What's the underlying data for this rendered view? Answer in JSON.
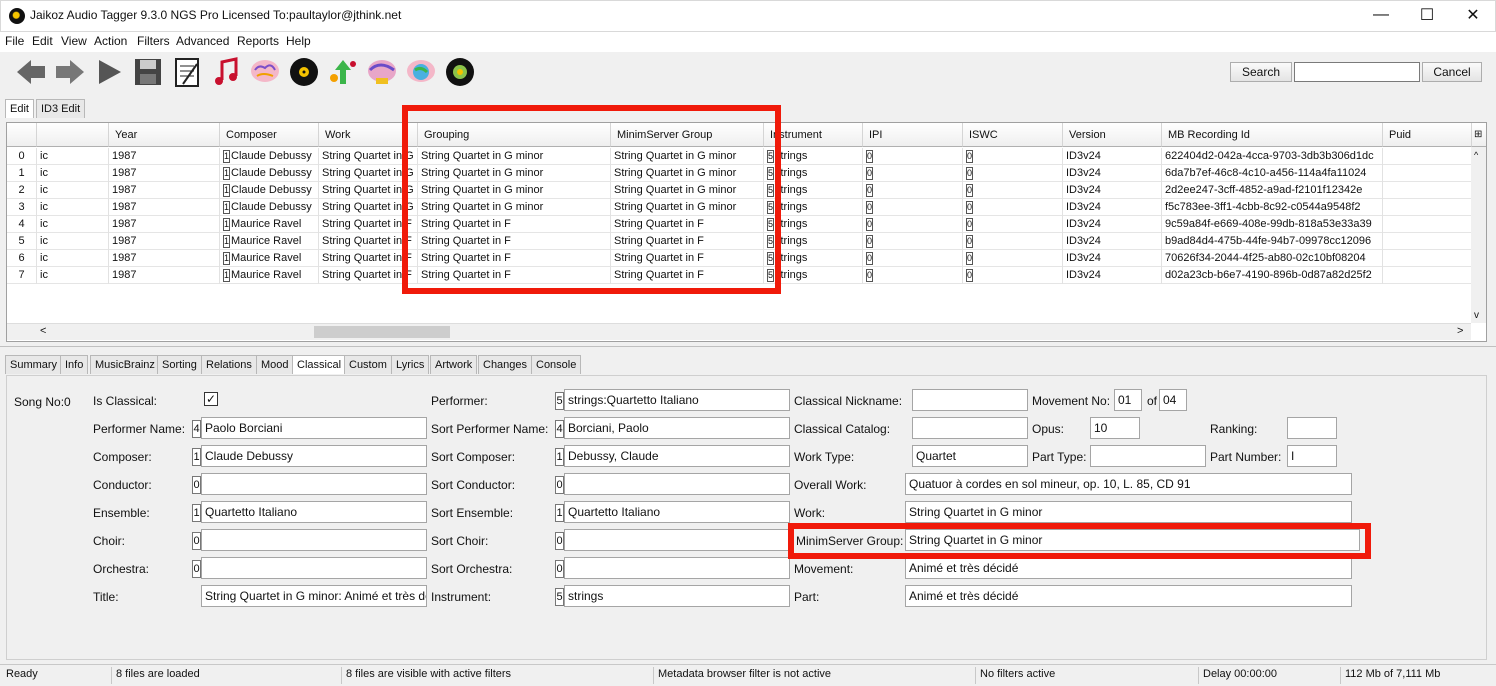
{
  "window": {
    "title": "Jaikoz Audio Tagger 9.3.0 NGS Pro Licensed To:paultaylor@jthink.net",
    "minimize": "—",
    "maximize": "☐",
    "close": "✕"
  },
  "menu": [
    "File",
    "Edit",
    "View",
    "Action",
    "Filters",
    "Advanced",
    "Reports",
    "Help"
  ],
  "toolbar": {
    "icons": [
      "back-arrow-icon",
      "forward-arrow-icon",
      "play-icon",
      "save-icon",
      "notepad-icon",
      "music-note-icon",
      "brain-icon",
      "vinyl-record-icon",
      "upload-tree-icon",
      "brain-sweep-icon",
      "brain-globe-icon",
      "disc-icon"
    ],
    "search_label": "Search",
    "cancel_label": "Cancel",
    "search_value": ""
  },
  "top_tabs": [
    "Edit",
    "ID3 Edit"
  ],
  "grid": {
    "columns": [
      "",
      "Year",
      "Composer",
      "Work",
      "Grouping",
      "MinimServer Group",
      "Instrument",
      "IPI",
      "ISWC",
      "Version",
      "MB Recording Id",
      "Puid"
    ],
    "rows": [
      {
        "n": "0",
        "c": "ic",
        "year": "1987",
        "cc": "1",
        "composer": "Claude Debussy",
        "work": "String Quartet in G minor",
        "grouping": "String Quartet in G minor",
        "msg": "String Quartet in G minor",
        "ic": "5",
        "instrument": "strings",
        "ipi": "0",
        "iswc": "0",
        "version": "ID3v24",
        "mbid": "622404d2-042a-4cca-9703-3db3b306d1dc"
      },
      {
        "n": "1",
        "c": "ic",
        "year": "1987",
        "cc": "1",
        "composer": "Claude Debussy",
        "work": "String Quartet in G minor",
        "grouping": "String Quartet in G minor",
        "msg": "String Quartet in G minor",
        "ic": "5",
        "instrument": "strings",
        "ipi": "0",
        "iswc": "0",
        "version": "ID3v24",
        "mbid": "6da7b7ef-46c8-4c10-a456-114a4fa11024"
      },
      {
        "n": "2",
        "c": "ic",
        "year": "1987",
        "cc": "1",
        "composer": "Claude Debussy",
        "work": "String Quartet in G minor",
        "grouping": "String Quartet in G minor",
        "msg": "String Quartet in G minor",
        "ic": "5",
        "instrument": "strings",
        "ipi": "0",
        "iswc": "0",
        "version": "ID3v24",
        "mbid": "2d2ee247-3cff-4852-a9ad-f2101f12342e"
      },
      {
        "n": "3",
        "c": "ic",
        "year": "1987",
        "cc": "1",
        "composer": "Claude Debussy",
        "work": "String Quartet in G minor",
        "grouping": "String Quartet in G minor",
        "msg": "String Quartet in G minor",
        "ic": "5",
        "instrument": "strings",
        "ipi": "0",
        "iswc": "0",
        "version": "ID3v24",
        "mbid": "f5c783ee-3ff1-4cbb-8c92-c0544a9548f2"
      },
      {
        "n": "4",
        "c": "ic",
        "year": "1987",
        "cc": "1",
        "composer": "Maurice Ravel",
        "work": "String Quartet in F",
        "grouping": "String Quartet in F",
        "msg": "String Quartet in F",
        "ic": "5",
        "instrument": "strings",
        "ipi": "0",
        "iswc": "0",
        "version": "ID3v24",
        "mbid": "9c59a84f-e669-408e-99db-818a53e33a39"
      },
      {
        "n": "5",
        "c": "ic",
        "year": "1987",
        "cc": "1",
        "composer": "Maurice Ravel",
        "work": "String Quartet in F",
        "grouping": "String Quartet in F",
        "msg": "String Quartet in F",
        "ic": "5",
        "instrument": "strings",
        "ipi": "0",
        "iswc": "0",
        "version": "ID3v24",
        "mbid": "b9ad84d4-475b-44fe-94b7-09978cc12096"
      },
      {
        "n": "6",
        "c": "ic",
        "year": "1987",
        "cc": "1",
        "composer": "Maurice Ravel",
        "work": "String Quartet in F",
        "grouping": "String Quartet in F",
        "msg": "String Quartet in F",
        "ic": "5",
        "instrument": "strings",
        "ipi": "0",
        "iswc": "0",
        "version": "ID3v24",
        "mbid": "70626f34-2044-4f25-ab80-02c10bf08204"
      },
      {
        "n": "7",
        "c": "ic",
        "year": "1987",
        "cc": "1",
        "composer": "Maurice Ravel",
        "work": "String Quartet in F",
        "grouping": "String Quartet in F",
        "msg": "String Quartet in F",
        "ic": "5",
        "instrument": "strings",
        "ipi": "0",
        "iswc": "0",
        "version": "ID3v24",
        "mbid": "d02a23cb-b6e7-4190-896b-0d87a82d25f2"
      }
    ]
  },
  "bottom_tabs": [
    "Summary",
    "Info",
    "MusicBrainz",
    "Sorting",
    "Relations",
    "Mood",
    "Classical",
    "Custom",
    "Lyrics",
    "Artwork",
    "Changes",
    "Console"
  ],
  "form": {
    "song_no": "Song No:0",
    "is_classical_label": "Is Classical:",
    "is_classical_check": "✓",
    "performer_name_label": "Performer Name:",
    "performer_name_count": "4",
    "performer_name": "Paolo Borciani",
    "composer_label": "Composer:",
    "composer_count": "1",
    "composer": "Claude Debussy",
    "conductor_label": "Conductor:",
    "conductor_count": "0",
    "conductor": "",
    "ensemble_label": "Ensemble:",
    "ensemble_count": "1",
    "ensemble": "Quartetto Italiano",
    "choir_label": "Choir:",
    "choir_count": "0",
    "choir": "",
    "orchestra_label": "Orchestra:",
    "orchestra_count": "0",
    "orchestra": "",
    "title_label": "Title:",
    "title": "String Quartet in G minor: Animé et très décidé",
    "performer_label": "Performer:",
    "performer_count": "5",
    "performer": "strings:Quartetto Italiano",
    "sort_performer_name_label": "Sort Performer Name:",
    "sort_performer_name_count": "4",
    "sort_performer_name": "Borciani, Paolo",
    "sort_composer_label": "Sort Composer:",
    "sort_composer_count": "1",
    "sort_composer": "Debussy, Claude",
    "sort_conductor_label": "Sort Conductor:",
    "sort_conductor_count": "0",
    "sort_conductor": "",
    "sort_ensemble_label": "Sort Ensemble:",
    "sort_ensemble_count": "1",
    "sort_ensemble": "Quartetto Italiano",
    "sort_choir_label": "Sort Choir:",
    "sort_choir_count": "0",
    "sort_choir": "",
    "sort_orchestra_label": "Sort Orchestra:",
    "sort_orchestra_count": "0",
    "sort_orchestra": "",
    "instrument_label": "Instrument:",
    "instrument_count": "5",
    "instrument": "strings",
    "classical_nickname_label": "Classical Nickname:",
    "classical_nickname": "",
    "classical_catalog_label": "Classical Catalog:",
    "classical_catalog": "",
    "work_type_label": "Work Type:",
    "work_type": "Quartet",
    "overall_work_label": "Overall Work:",
    "overall_work": "Quatuor à cordes en sol mineur, op. 10, L. 85, CD 91",
    "work_label": "Work:",
    "work": "String Quartet in G minor",
    "minimserver_group_label": "MinimServer Group:",
    "minimserver_group": "String Quartet in G minor",
    "movement_label": "Movement:",
    "movement": "Animé et très décidé",
    "part_label": "Part:",
    "part": "Animé et très décidé",
    "movement_no_label": "Movement No:",
    "movement_no": "01",
    "of_label": "of",
    "movement_total": "04",
    "opus_label": "Opus:",
    "opus": "10",
    "ranking_label": "Ranking:",
    "ranking": "",
    "part_type_label": "Part Type:",
    "part_type": "",
    "part_number_label": "Part Number:",
    "part_number": "I"
  },
  "status": [
    "Ready",
    "8 files are loaded",
    "8 files are visible with active filters",
    "Metadata browser filter is not active",
    "No filters active",
    "Delay 00:00:00",
    "112 Mb of 7,111 Mb"
  ],
  "colors": {
    "highlight": "#f01a0a"
  }
}
